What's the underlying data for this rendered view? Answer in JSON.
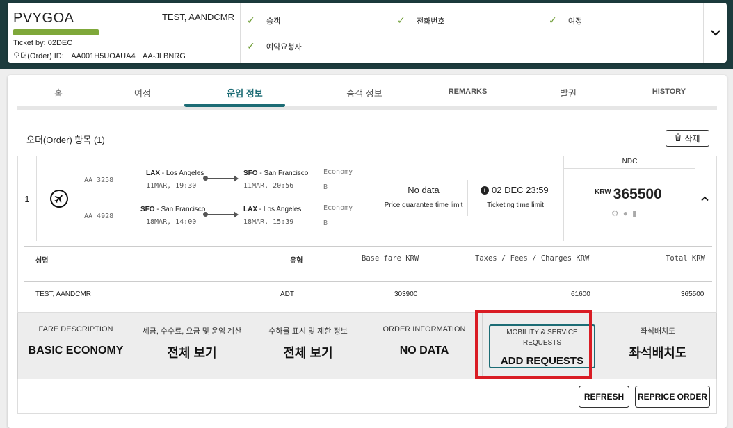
{
  "header": {
    "pnr": "PVYGOA",
    "pax_name": "TEST, AANDCMR",
    "progress": 1.0,
    "ticket_by": "Ticket by: 02DEC",
    "order_label": "오더(Order) ID:",
    "order_id": "AA001H5UOAUA4",
    "booking_ref": "AA-JLBNRG",
    "checks": [
      "승객",
      "전화번호",
      "여정",
      "예약요청자"
    ],
    "toggle_icon": "chevron-down-icon"
  },
  "tabs": [
    {
      "label": "홈"
    },
    {
      "label": "여정"
    },
    {
      "label": "운임 정보",
      "active": true
    },
    {
      "label": "승객 정보"
    },
    {
      "label": "REMARKS"
    },
    {
      "label": "발권"
    },
    {
      "label": "HISTORY"
    }
  ],
  "items_title": "오더(Order) 항목 (1)",
  "delete_label": "삭제",
  "item": {
    "index": "1",
    "segments": [
      {
        "flight": "AA 3258",
        "from_code": "LAX",
        "from_city": " - Los Angeles",
        "dep": "11MAR, 19:30",
        "to_code": "SFO",
        "to_city": " - San Francisco",
        "arr": "11MAR, 20:56",
        "cabin": "Economy",
        "class": "B"
      },
      {
        "flight": "AA 4928",
        "from_code": "SFO",
        "from_city": " - San Francisco",
        "dep": "18MAR, 14:00",
        "to_code": "LAX",
        "to_city": " - Los Angeles",
        "arr": "18MAR, 15:39",
        "cabin": "Economy",
        "class": "B"
      }
    ],
    "price_guarantee_value": "No data",
    "price_guarantee_label": "Price guarantee time limit",
    "ticketing_value": "02 DEC 23:59",
    "ticketing_label": "Ticketing time limit",
    "ndc_label": "NDC",
    "currency": "KRW",
    "total": "365500"
  },
  "fare_table": {
    "headers": {
      "name": "성명",
      "type": "유형",
      "base": "Base fare KRW",
      "taxes": "Taxes / Fees / Charges KRW",
      "total": "Total KRW"
    },
    "row": {
      "name": "TEST, AANDCMR",
      "type": "ADT",
      "base": "303900",
      "taxes": "61600",
      "total": "365500"
    }
  },
  "strip": {
    "fare_desc_label": "FARE DESCRIPTION",
    "fare_desc_value": "BASIC ECONOMY",
    "tax_label": "세금, 수수료, 요금 및 운임 계산",
    "tax_value": "전체 보기",
    "baggage_label": "수하물 표시 및 제한 정보",
    "baggage_value": "전체 보기",
    "order_info_label": "ORDER INFORMATION",
    "order_info_value": "NO DATA",
    "mobility_label_1": "MOBILITY & SERVICE",
    "mobility_label_2": "REQUESTS",
    "mobility_value": "ADD REQUESTS",
    "seat_label": "좌석배치도",
    "seat_value": "좌석배치도"
  },
  "buttons": {
    "refresh": "REFRESH",
    "reprice": "REPRICE ORDER"
  },
  "colors": {
    "accent": "#1c6c75",
    "check": "#6a9a2f",
    "progress": "#7fa83a",
    "highlight": "#d91c24",
    "header_bg": "#1c3b3d"
  }
}
